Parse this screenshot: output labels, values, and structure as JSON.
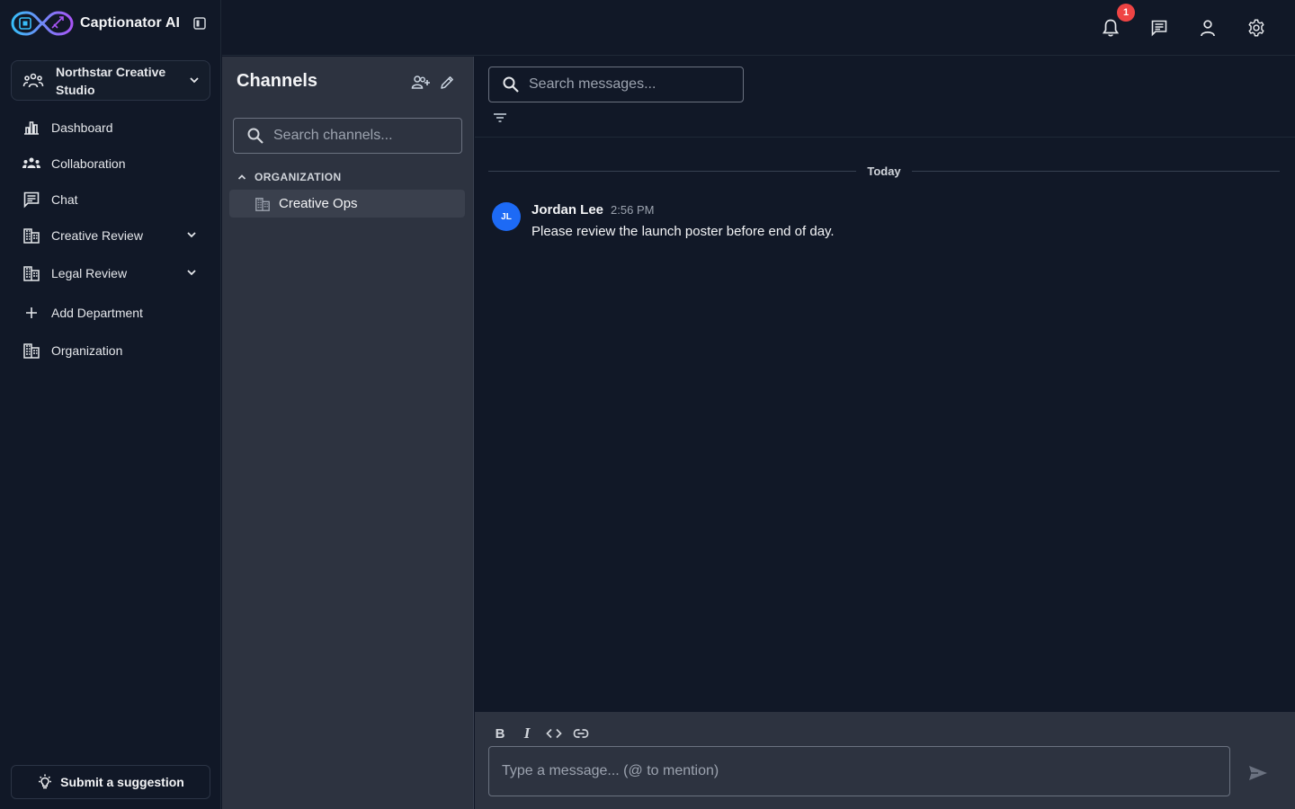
{
  "app": {
    "name": "Captionator AI"
  },
  "workspace": {
    "name": "Northstar Creative Studio"
  },
  "sidebar": {
    "items": [
      {
        "label": "Dashboard",
        "icon": "bar-chart-icon"
      },
      {
        "label": "Collaboration",
        "icon": "groups-icon"
      },
      {
        "label": "Chat",
        "icon": "chat-icon"
      },
      {
        "label": "Creative Review",
        "icon": "building-icon",
        "expandable": true
      },
      {
        "label": "Legal Review",
        "icon": "building-icon",
        "expandable": true
      },
      {
        "label": "Add Department",
        "icon": "plus-icon"
      },
      {
        "label": "Organization",
        "icon": "building-icon"
      }
    ],
    "suggestion_label": "Submit a suggestion"
  },
  "topbar": {
    "notification_count": "1"
  },
  "channels": {
    "title": "Channels",
    "search_placeholder": "Search channels...",
    "groups": [
      {
        "label": "ORGANIZATION",
        "channels": [
          {
            "name": "Creative Ops",
            "selected": true
          }
        ]
      }
    ]
  },
  "chat": {
    "search_placeholder": "Search messages...",
    "day_label": "Today",
    "messages": [
      {
        "initials": "JL",
        "author": "Jordan Lee",
        "time": "2:56 PM",
        "text": "Please review the launch poster before end of day."
      }
    ],
    "composer_placeholder": "Type a message... (@ to mention)",
    "format": {
      "bold": "B",
      "italic": "I"
    }
  },
  "colors": {
    "background": "#111827",
    "panel": "#2d3340",
    "accent_avatar": "#1d6af5",
    "badge": "#ef4444"
  }
}
